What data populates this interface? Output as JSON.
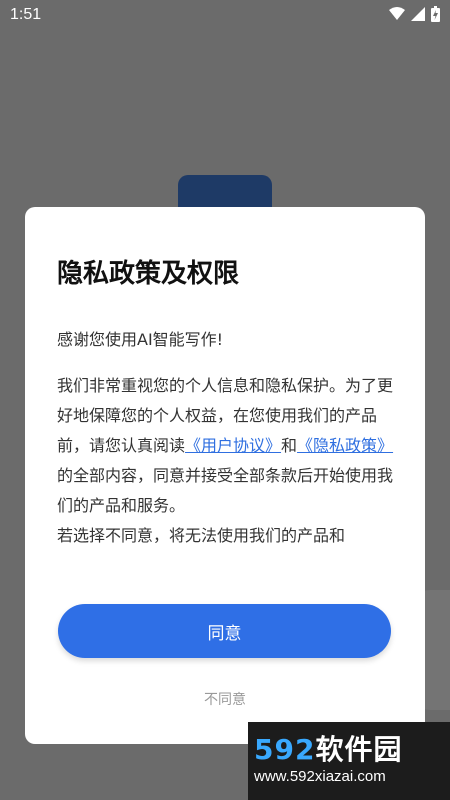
{
  "status_bar": {
    "time": "1:51",
    "icons": [
      "wifi-icon",
      "signal-icon",
      "battery-charging-icon"
    ]
  },
  "dialog": {
    "title": "隐私政策及权限",
    "greeting": "感谢您使用AI智能写作!",
    "body_part1": "我们非常重视您的个人信息和隐私保护。为了更好地保障您的个人权益，在您使用我们的产品前，请您认真阅读",
    "link_user_agreement": "《用户协议》",
    "connector": "和",
    "link_privacy_policy": "《隐私政策》",
    "body_part2": "的全部内容，同意并接受全部条款后开始使用我们的产品和服务。",
    "body_part3": "若选择不同意，将无法使用我们的产品和",
    "agree_label": "同意",
    "disagree_label": "不同意"
  },
  "watermark": {
    "brand_num": "592",
    "brand_text": "软件园",
    "url": "www.592xiazai.com"
  },
  "colors": {
    "overlay": "#6b6b6b",
    "accent": "#2f6fe6",
    "link": "#2f6fe0"
  }
}
